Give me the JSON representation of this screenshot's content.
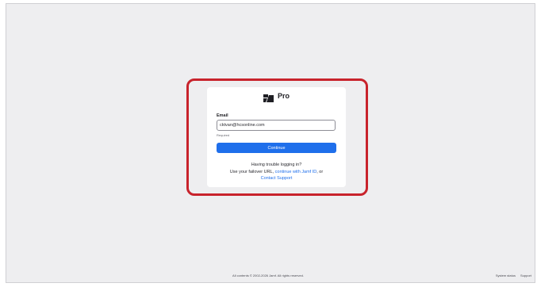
{
  "brand": {
    "logo_icon": "jamf-logo-icon",
    "name": "Pro"
  },
  "form": {
    "email_label": "Email",
    "email_value": "cktvan@hcsonline.com",
    "helper_text": "Required",
    "continue_label": "Continue"
  },
  "help": {
    "line1": "Having trouble logging in?",
    "line2_prefix": "Use your failover URL,",
    "jamf_id_link": "continue with Jamf ID",
    "line2_suffix": ", or",
    "support_link": "Contact Support"
  },
  "footer": {
    "copyright": "All contents © 2002-2026 Jamf. All rights reserved.",
    "system_status": "System status",
    "support": "Support"
  },
  "colors": {
    "accent": "#1f6feb",
    "highlight": "#c8232c",
    "background": "#eeeef0"
  }
}
